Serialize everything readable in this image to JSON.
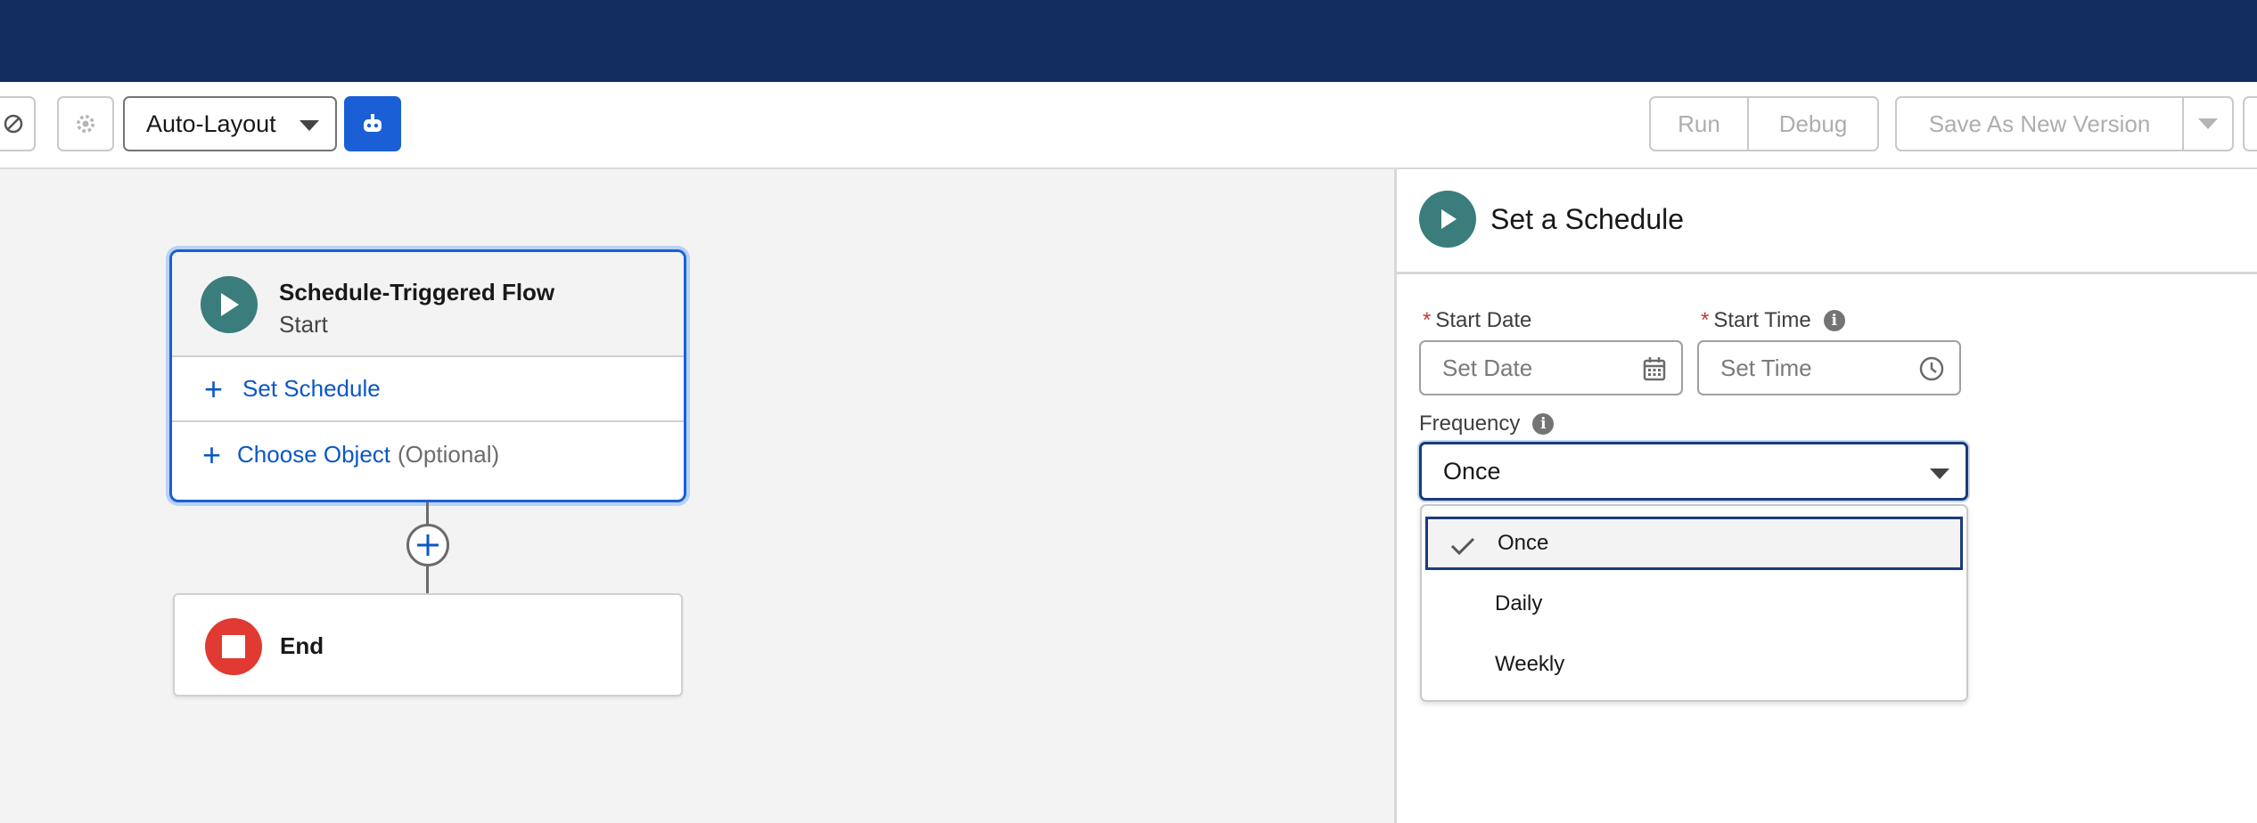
{
  "toolbar": {
    "layout_select": "Auto-Layout",
    "run_label": "Run",
    "debug_label": "Debug",
    "save_new_version_label": "Save As New Version"
  },
  "canvas": {
    "start_node": {
      "title": "Schedule-Triggered Flow",
      "subtitle": "Start",
      "set_schedule": "Set Schedule",
      "choose_object": "Choose Object",
      "choose_object_optional": "(Optional)"
    },
    "end_node": {
      "title": "End"
    }
  },
  "panel": {
    "title": "Set a Schedule",
    "start_date": {
      "label": "Start Date",
      "placeholder": "Set Date"
    },
    "start_time": {
      "label": "Start Time",
      "placeholder": "Set Time"
    },
    "frequency": {
      "label": "Frequency",
      "value": "Once",
      "options": [
        "Once",
        "Daily",
        "Weekly"
      ],
      "selected": "Once"
    }
  },
  "colors": {
    "topbar": "#112c5e",
    "brand_button": "#1b5fd6",
    "start_icon": "#3a7d7c",
    "end_icon": "#e03a32",
    "link": "#0b57c5"
  }
}
